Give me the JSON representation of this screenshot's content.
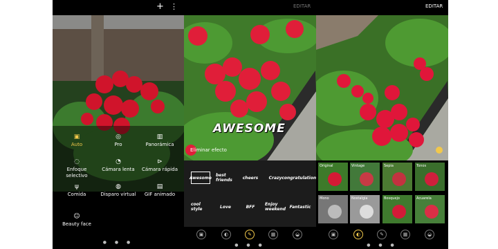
{
  "camera_screen": {
    "modes": [
      {
        "label": "Auto",
        "icon": "auto-icon",
        "glyph": "▣",
        "active": true
      },
      {
        "label": "Pro",
        "icon": "pro-icon",
        "glyph": "◎",
        "active": false
      },
      {
        "label": "Panorámica",
        "icon": "panorama-icon",
        "glyph": "▥",
        "active": false
      },
      {
        "label": "Enfoque selectivo",
        "icon": "focus-icon",
        "glyph": "◌",
        "active": false
      },
      {
        "label": "Cámara lenta",
        "icon": "slow-motion-icon",
        "glyph": "◔",
        "active": false
      },
      {
        "label": "Cámara rápida",
        "icon": "hyperlapse-icon",
        "glyph": "⊳",
        "active": false
      },
      {
        "label": "Comida",
        "icon": "food-icon",
        "glyph": "ψ",
        "active": false
      },
      {
        "label": "Disparo virtual",
        "icon": "virtual-shot-icon",
        "glyph": "◍",
        "active": false
      },
      {
        "label": "GIF animado",
        "icon": "gif-icon",
        "glyph": "▤",
        "active": false
      },
      {
        "label": "Beauty face",
        "icon": "beauty-face-icon",
        "glyph": "☺",
        "active": false
      }
    ],
    "top_icons": {
      "add": "+",
      "more": "⋮"
    },
    "page_dots": "● ● ●"
  },
  "sticker_editor": {
    "edit_label": "EDITAR",
    "sticker_text": "AWESOME",
    "remove_effect_label": "Eliminar efecto",
    "stickers": [
      "Awesome",
      "best friends",
      "cheers",
      "Crazy",
      "congratulations",
      "cool style",
      "Love",
      "BFF",
      "Enjoy weekend",
      "Fantastic"
    ],
    "tools": [
      "▣",
      "◐",
      "✎",
      "▦",
      "◒"
    ],
    "page_dots": "● ● ●"
  },
  "filter_editor": {
    "edit_label": "EDITAR",
    "filters": [
      "Original",
      "Vintage",
      "Sepia",
      "Tonos",
      "Mono",
      "Nostalgia",
      "Bosquejo",
      "Acuarela"
    ],
    "tools": [
      "▣",
      "◐",
      "✎",
      "▦",
      "◒"
    ],
    "page_dots": "● ● ●",
    "colors": {
      "accent": "#f2c84b",
      "selected_filter": "#2fb8a6"
    }
  }
}
